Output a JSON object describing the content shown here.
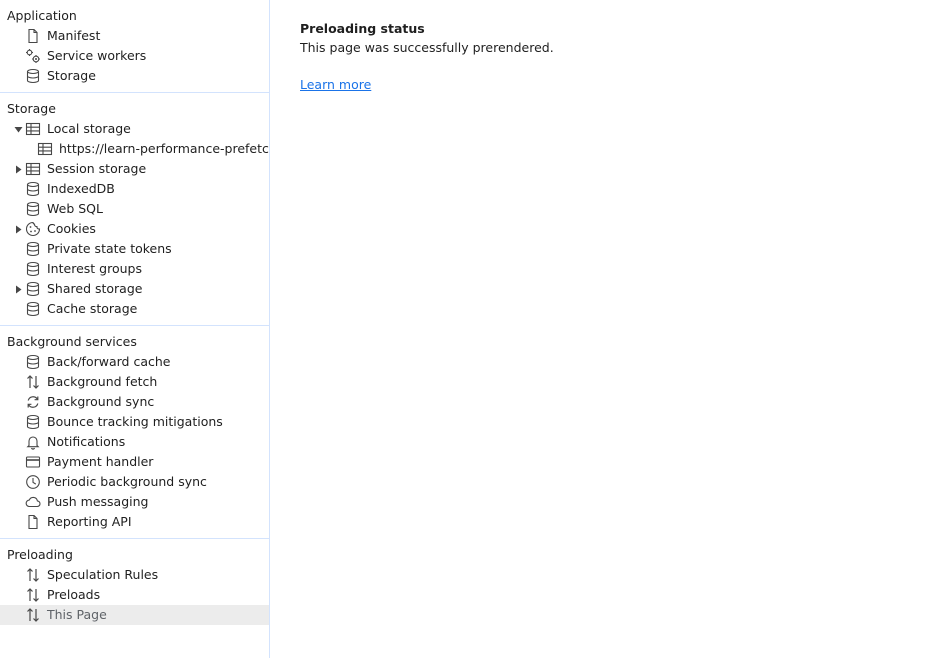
{
  "sidebar": {
    "application": {
      "title": "Application",
      "items": [
        {
          "label": "Manifest",
          "icon": "file-icon"
        },
        {
          "label": "Service workers",
          "icon": "gears-icon"
        },
        {
          "label": "Storage",
          "icon": "database-icon"
        }
      ]
    },
    "storage": {
      "title": "Storage",
      "items": [
        {
          "label": "Local storage",
          "icon": "table-icon",
          "expanded": true
        },
        {
          "label": "https://learn-performance-prefetch-pre",
          "icon": "table-icon"
        },
        {
          "label": "Session storage",
          "icon": "table-icon",
          "expanded": false
        },
        {
          "label": "IndexedDB",
          "icon": "database-icon"
        },
        {
          "label": "Web SQL",
          "icon": "database-icon"
        },
        {
          "label": "Cookies",
          "icon": "cookie-icon",
          "expanded": false
        },
        {
          "label": "Private state tokens",
          "icon": "database-icon"
        },
        {
          "label": "Interest groups",
          "icon": "database-icon"
        },
        {
          "label": "Shared storage",
          "icon": "database-icon",
          "expanded": false
        },
        {
          "label": "Cache storage",
          "icon": "database-icon"
        }
      ]
    },
    "background": {
      "title": "Background services",
      "items": [
        {
          "label": "Back/forward cache",
          "icon": "database-icon"
        },
        {
          "label": "Background fetch",
          "icon": "arrows-up-down-icon"
        },
        {
          "label": "Background sync",
          "icon": "sync-icon"
        },
        {
          "label": "Bounce tracking mitigations",
          "icon": "database-icon"
        },
        {
          "label": "Notifications",
          "icon": "bell-icon"
        },
        {
          "label": "Payment handler",
          "icon": "credit-card-icon"
        },
        {
          "label": "Periodic background sync",
          "icon": "clock-icon"
        },
        {
          "label": "Push messaging",
          "icon": "cloud-icon"
        },
        {
          "label": "Reporting API",
          "icon": "file-icon"
        }
      ]
    },
    "preloading": {
      "title": "Preloading",
      "items": [
        {
          "label": "Speculation Rules",
          "icon": "arrows-up-down-icon"
        },
        {
          "label": "Preloads",
          "icon": "arrows-up-down-icon"
        },
        {
          "label": "This Page",
          "icon": "arrows-up-down-icon",
          "selected": true
        }
      ]
    }
  },
  "main": {
    "status_title": "Preloading status",
    "status_text": "This page was successfully prerendered.",
    "learn_more": "Learn more"
  },
  "colors": {
    "divider": "#d3e3fd",
    "selected_bg": "#ececec",
    "link": "#1a73e8",
    "text": "#1f1f1f"
  }
}
